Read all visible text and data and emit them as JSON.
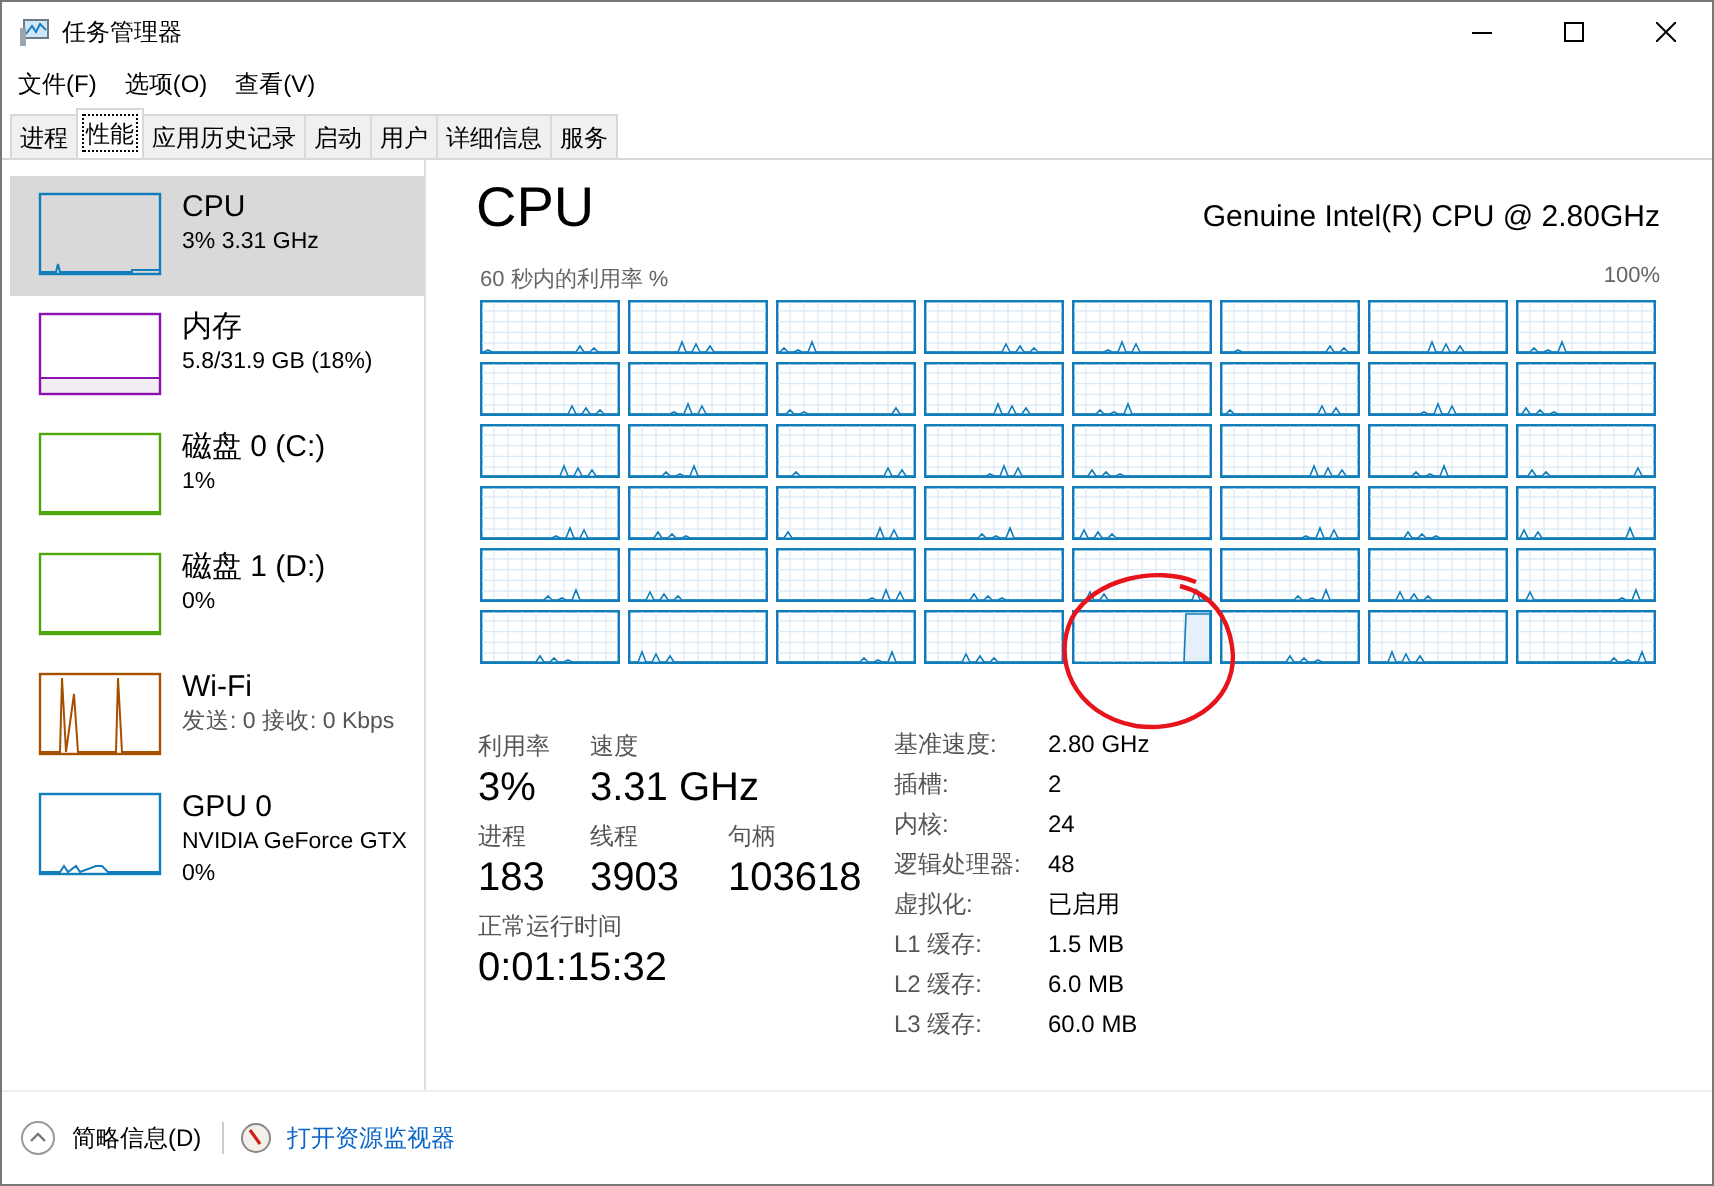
{
  "window": {
    "title": "任务管理器"
  },
  "menu": [
    "文件(F)",
    "选项(O)",
    "查看(V)"
  ],
  "tabs": [
    {
      "label": "进程",
      "selected": false
    },
    {
      "label": "性能",
      "selected": true
    },
    {
      "label": "应用历史记录",
      "selected": false
    },
    {
      "label": "启动",
      "selected": false
    },
    {
      "label": "用户",
      "selected": false
    },
    {
      "label": "详细信息",
      "selected": false
    },
    {
      "label": "服务",
      "selected": false
    }
  ],
  "sidebar": {
    "items": [
      {
        "kind": "cpu",
        "name": "CPU",
        "details": [
          "3% 3.31 GHz"
        ],
        "color": "#117dbb",
        "selected": true
      },
      {
        "kind": "memory",
        "name": "内存",
        "details": [
          "5.8/31.9 GB (18%)"
        ],
        "color": "#8b12ae",
        "selected": false
      },
      {
        "kind": "disk",
        "name": "磁盘 0 (C:)",
        "details": [
          "1%"
        ],
        "color": "#4da60c",
        "selected": false
      },
      {
        "kind": "disk",
        "name": "磁盘 1 (D:)",
        "details": [
          "0%"
        ],
        "color": "#4da60c",
        "selected": false
      },
      {
        "kind": "network",
        "name": "Wi-Fi",
        "details": [
          "发送: 0 接收: 0 Kbps"
        ],
        "color": "#a74f01",
        "selected": false
      },
      {
        "kind": "gpu",
        "name": "GPU 0",
        "details": [
          "NVIDIA GeForce GTX",
          "0%"
        ],
        "color": "#117dbb",
        "selected": false
      }
    ]
  },
  "detail": {
    "title": "CPU",
    "model": "Genuine Intel(R) CPU @ 2.80GHz",
    "graph_label": "60 秒内的利用率 %",
    "graph_max": "100%",
    "stats": [
      [
        {
          "label": "利用率",
          "value": "3%"
        },
        {
          "label": "速度",
          "value": "3.31 GHz"
        }
      ],
      [
        {
          "label": "进程",
          "value": "183"
        },
        {
          "label": "线程",
          "value": "3903"
        },
        {
          "label": "句柄",
          "value": "103618"
        }
      ],
      [
        {
          "label": "正常运行时间",
          "value": "0:01:15:32"
        }
      ]
    ],
    "specs": [
      {
        "label": "基准速度:",
        "value": "2.80 GHz"
      },
      {
        "label": "插槽:",
        "value": "2"
      },
      {
        "label": "内核:",
        "value": "24"
      },
      {
        "label": "逻辑处理器:",
        "value": "48"
      },
      {
        "label": "虚拟化:",
        "value": "已启用"
      },
      {
        "label": "L1 缓存:",
        "value": "1.5 MB"
      },
      {
        "label": "L2 缓存:",
        "value": "6.0 MB"
      },
      {
        "label": "L3 缓存:",
        "value": "60.0 MB"
      }
    ]
  },
  "footer": {
    "summary": "简略信息(D)",
    "link": "打开资源监视器"
  }
}
